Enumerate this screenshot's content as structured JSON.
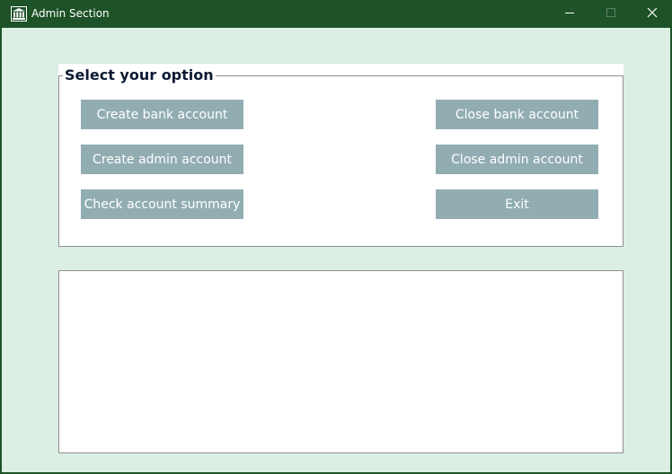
{
  "window": {
    "title": "Admin Section",
    "app_icon": "bank-icon",
    "controls": {
      "minimize": "minimize-icon",
      "maximize": "maximize-icon",
      "close": "close-icon"
    }
  },
  "options": {
    "heading": "Select your option",
    "left_buttons": [
      {
        "label": "Create bank account"
      },
      {
        "label": "Create admin account"
      },
      {
        "label": "Check account summary"
      }
    ],
    "right_buttons": [
      {
        "label": "Close bank account"
      },
      {
        "label": "Close admin account"
      },
      {
        "label": "Exit"
      }
    ]
  },
  "output": {
    "text": ""
  },
  "colors": {
    "titlebar": "#1e5227",
    "window_background": "#dbefe3",
    "button_background": "#91adb2",
    "button_text": "#ffffff",
    "heading_text": "#0d1a33"
  }
}
